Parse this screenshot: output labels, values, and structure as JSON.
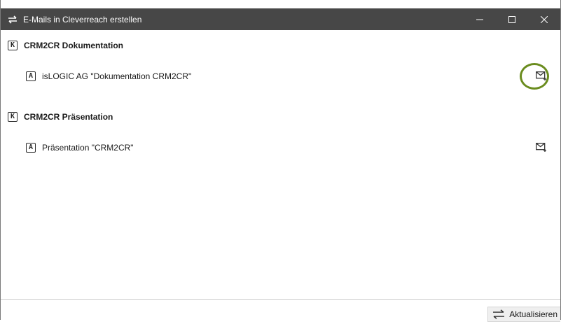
{
  "window": {
    "title": "E-Mails in Cleverreach erstellen"
  },
  "groups": [
    {
      "badge": "K",
      "label": "CRM2CR Dokumentation",
      "items": [
        {
          "badge": "A",
          "label": "isLOGIC AG \"Dokumentation CRM2CR\"",
          "highlighted": true
        }
      ]
    },
    {
      "badge": "K",
      "label": "CRM2CR Präsentation",
      "items": [
        {
          "badge": "A",
          "label": "Präsentation \"CRM2CR\"",
          "highlighted": false
        }
      ]
    }
  ],
  "footer": {
    "refresh_label": "Aktualisieren"
  },
  "colors": {
    "titlebar": "#474747",
    "highlight": "#6a8c1e"
  }
}
